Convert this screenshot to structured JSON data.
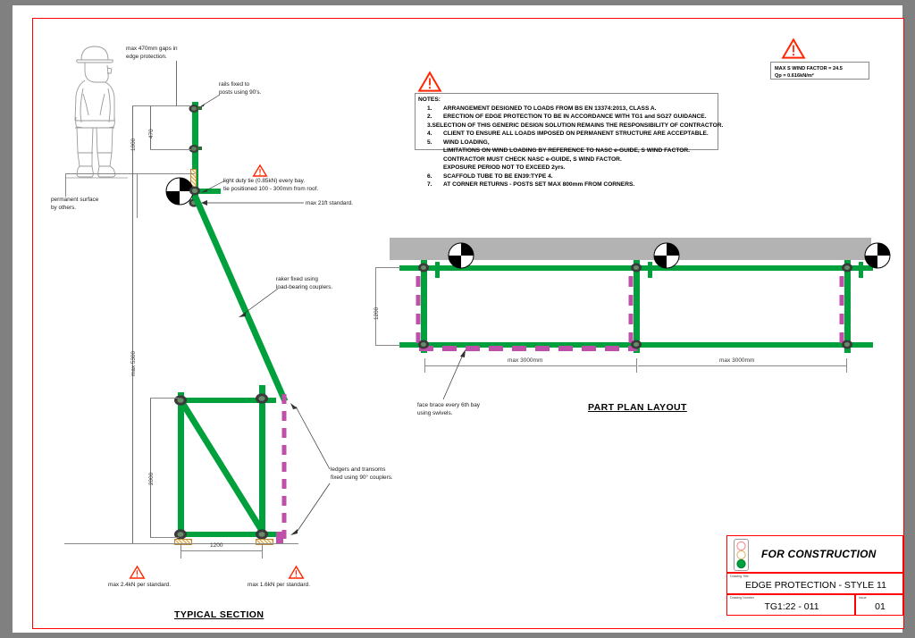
{
  "sheet": {
    "border_color": "#ff0000",
    "background": "#ffffff",
    "page_background": "#808080"
  },
  "warning_symbol": "warning-triangle",
  "wind_box": {
    "line1": "MAX S WIND FACTOR = 24.5",
    "line2": "Qp = 0.616kN/m²"
  },
  "notes": {
    "heading": "NOTES:",
    "items": [
      {
        "num": "1.",
        "text": "ARRANGEMENT DESIGNED TO LOADS FROM BS EN 13374:2013, CLASS A."
      },
      {
        "num": "2.",
        "text": "ERECTION OF EDGE PROTECTION TO BE IN ACCORDANCE WITH TG1 and SG27 GUIDANCE."
      },
      {
        "num": "3.",
        "text": "SELECTION OF THIS GENERIC DESIGN SOLUTION REMAINS THE RESPONSIBILITY OF CONTRACTOR."
      },
      {
        "num": "4.",
        "text": "CLIENT TO ENSURE ALL LOADS IMPOSED ON PERMANENT STRUCTURE ARE ACCEPTABLE."
      },
      {
        "num": "5.",
        "text": "WIND LOADING,"
      },
      {
        "num": "",
        "text": "LIMITATIONS ON WIND LOADING BY REFERENCE TO NASC e-GUIDE, S WIND FACTOR."
      },
      {
        "num": "",
        "text": "CONTRACTOR MUST CHECK NASC e-GUIDE, S WIND FACTOR."
      },
      {
        "num": "",
        "text": "EXPOSURE PERIOD NOT TO EXCEED 2yrs."
      },
      {
        "num": "6.",
        "text": "SCAFFOLD TUBE TO BE EN39:TYPE 4."
      },
      {
        "num": "7.",
        "text": "AT CORNER RETURNS - POSTS SET MAX 800mm FROM CORNERS."
      }
    ]
  },
  "section_view": {
    "title": "TYPICAL SECTION",
    "annotations": {
      "gaps": "max 470mm gaps in\nedge protection.",
      "rails": "rails fixed to\nposts using 90's.",
      "tie": "light duty tie (0.85kN) every bay.\ntie positioned 100 - 300mm from roof.",
      "standard": "max 21ft standard.",
      "raker": "raker fixed using\nload-bearing couplers.",
      "ledgers": "ledgers and transoms\nfixed using 90° couplers.",
      "surface": "permanent surface\nby others.",
      "load_left": "max 2.4kN per standard.",
      "load_right": "max 1.6kN per standard."
    },
    "dimensions": {
      "d470": "470",
      "d1000": "1000",
      "d5300": "max 5300",
      "d2000": "2000",
      "d1200": "1200"
    }
  },
  "plan_view": {
    "title": "PART PLAN LAYOUT",
    "dimensions": {
      "width_1200": "1200",
      "bay_left": "max 3000mm",
      "bay_right": "max 3000mm"
    },
    "annotations": {
      "face_brace": "face brace every 6th bay\nusing swivels."
    }
  },
  "title_block": {
    "status": "FOR CONSTRUCTION",
    "traffic_light": {
      "red": "#ffffff",
      "amber": "#ffffff",
      "green": "#00A03C"
    },
    "drawing_title_label": "Drawing Title",
    "drawing_title_value": "EDGE PROTECTION - STYLE 11",
    "drawing_number_label": "Drawing Number",
    "drawing_number_value": "TG1:22 - 011",
    "issue_label": "Issue",
    "issue_value": "01"
  }
}
